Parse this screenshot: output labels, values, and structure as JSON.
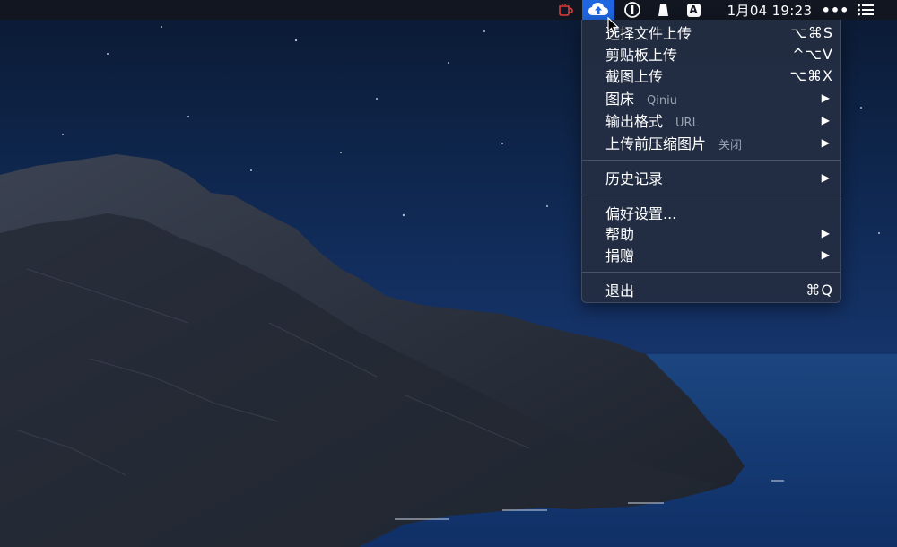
{
  "menubar": {
    "clock": "1月04 19:23",
    "more": "•••",
    "input_indicator": "A",
    "icons": [
      "coffee-cup-icon",
      "cloud-upload-icon",
      "onepassword-icon",
      "flag-icon",
      "input-source-icon",
      "notification-list-icon"
    ],
    "active_highlight": "#1e66e0"
  },
  "menu": {
    "items": [
      {
        "label": "选择文件上传",
        "shortcut": "⌥⌘S"
      },
      {
        "label": "剪贴板上传",
        "shortcut": "^⌥V"
      },
      {
        "label": "截图上传",
        "shortcut": "⌥⌘X"
      },
      {
        "label": "图床",
        "sub": "Qiniu",
        "submenu": "▶"
      },
      {
        "label": "输出格式",
        "sub": "URL",
        "submenu": "▶"
      },
      {
        "label": "上传前压缩图片",
        "sub": "关闭",
        "submenu": "▶"
      },
      {
        "label": "历史记录",
        "submenu": "▶"
      },
      {
        "label": "偏好设置...",
        "submenu": ""
      },
      {
        "label": "帮助",
        "submenu": "▶"
      },
      {
        "label": "捐赠",
        "submenu": "▶"
      },
      {
        "label": "退出",
        "shortcut": "⌘Q"
      }
    ]
  }
}
